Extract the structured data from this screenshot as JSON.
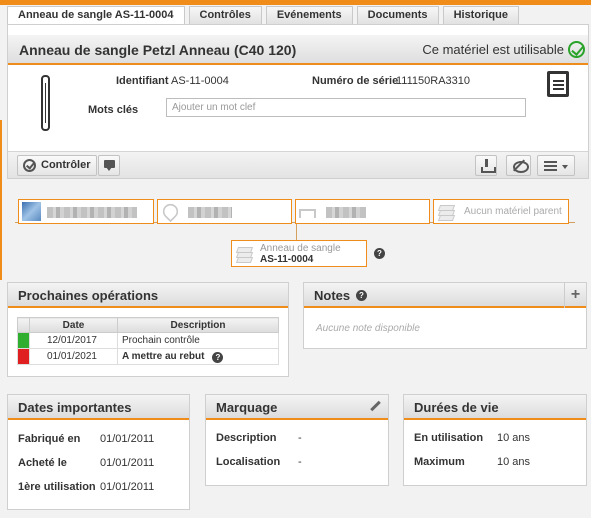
{
  "tabs": [
    {
      "label": "Anneau de sangle AS-11-0004"
    },
    {
      "label": "Contrôles"
    },
    {
      "label": "Evénements"
    },
    {
      "label": "Documents"
    },
    {
      "label": "Historique"
    }
  ],
  "header": {
    "title": "Anneau de sangle Petzl Anneau (C40 120)",
    "status": "Ce matériel est utilisable"
  },
  "details": {
    "identifiant_label": "Identifiant",
    "identifiant_value": "AS-11-0004",
    "serial_label": "Numéro de série",
    "serial_value": "111150RA3310",
    "keywords_label": "Mots clés",
    "keywords_placeholder": "Ajouter un mot clef"
  },
  "toolbar": {
    "control_label": "Contrôler"
  },
  "hierarchy": {
    "parent_label": "Aucun matériel parent",
    "current_type": "Anneau de sangle",
    "current_id": "AS-11-0004"
  },
  "operations": {
    "title": "Prochaines opérations",
    "columns": [
      "Date",
      "Description"
    ],
    "rows": [
      {
        "date": "12/01/2017",
        "description": "Prochain contrôle",
        "color": "#2fae2f"
      },
      {
        "date": "01/01/2021",
        "description": "A mettre au rebut",
        "color": "#e02020"
      }
    ]
  },
  "notes": {
    "title": "Notes",
    "empty": "Aucune note disponible"
  },
  "dates": {
    "title": "Dates importantes",
    "rows": [
      {
        "label": "Fabriqué en",
        "value": "01/01/2011"
      },
      {
        "label": "Acheté le",
        "value": "01/01/2011"
      },
      {
        "label": "1ère utilisation",
        "value": "01/01/2011"
      }
    ]
  },
  "marquage": {
    "title": "Marquage",
    "rows": [
      {
        "label": "Description",
        "value": "-"
      },
      {
        "label": "Localisation",
        "value": "-"
      }
    ]
  },
  "durees": {
    "title": "Durées de vie",
    "rows": [
      {
        "label": "En utilisation",
        "value": "10 ans"
      },
      {
        "label": "Maximum",
        "value": "10 ans"
      }
    ]
  },
  "colors": {
    "accent": "#f08c1a",
    "ok": "#29a329"
  }
}
